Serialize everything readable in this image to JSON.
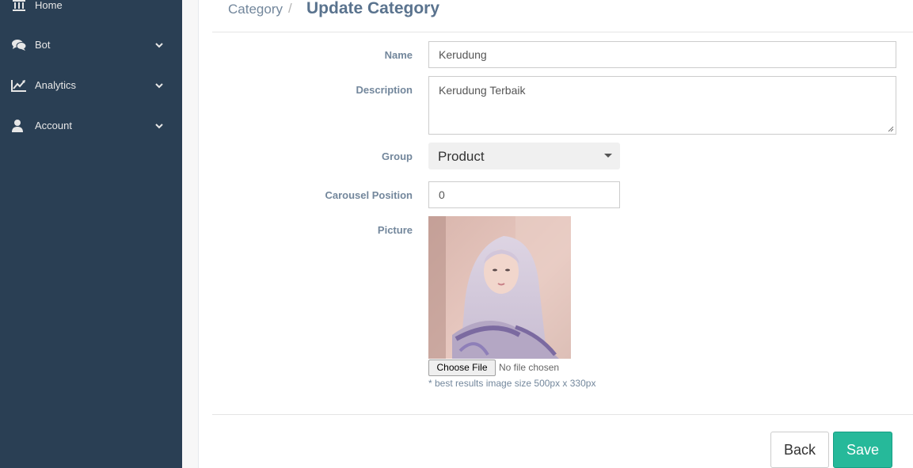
{
  "sidebar": {
    "items": [
      {
        "label": "Home",
        "icon": "home-icon"
      },
      {
        "label": "Bot",
        "icon": "comments-icon"
      },
      {
        "label": "Analytics",
        "icon": "line-chart-icon"
      },
      {
        "label": "Account",
        "icon": "user-icon"
      }
    ]
  },
  "breadcrumb": {
    "parent": "Category",
    "separator": "/",
    "current": "Update Category"
  },
  "form": {
    "name_label": "Name",
    "name_value": "Kerudung",
    "description_label": "Description",
    "description_value": "Kerudung Terbaik",
    "group_label": "Group",
    "group_value": "Product",
    "carousel_label": "Carousel Position",
    "carousel_value": "0",
    "picture_label": "Picture",
    "choose_file_label": "Choose File",
    "file_status": "No file chosen",
    "hint": "* best results image size 500px x 330px"
  },
  "actions": {
    "back_label": "Back",
    "save_label": "Save"
  },
  "colors": {
    "sidebar_bg": "#2a3f54",
    "save_button": "#26b99a"
  }
}
